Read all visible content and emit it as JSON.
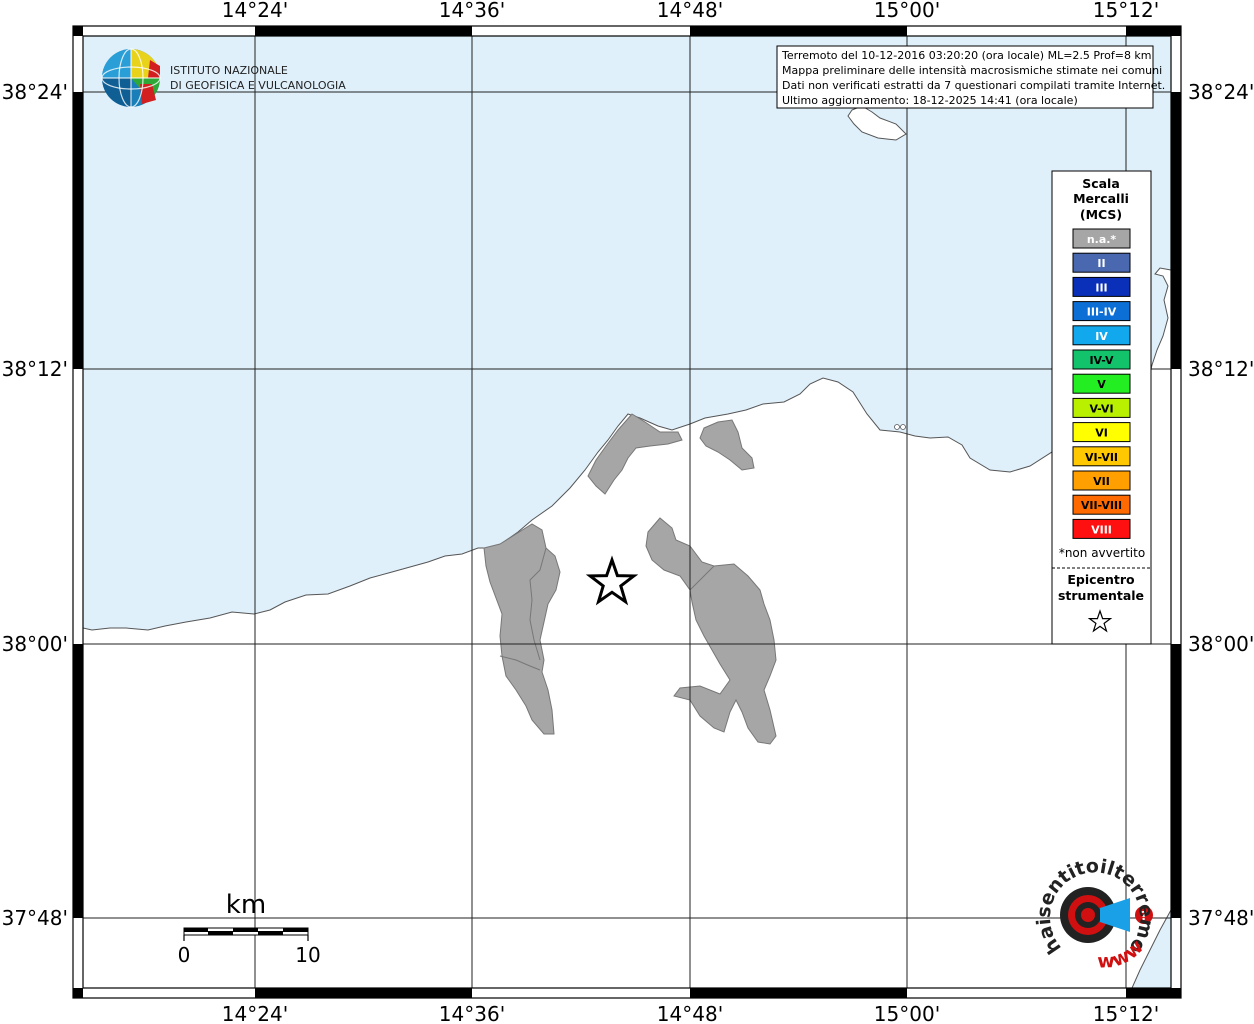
{
  "map": {
    "longitude_labels": [
      "14°24'",
      "14°36'",
      "14°48'",
      "15°00'",
      "15°12'"
    ],
    "latitude_labels": [
      "38°24'",
      "38°12'",
      "38°00'",
      "37°48'"
    ],
    "colors": {
      "sea": "#dff0fb",
      "land": "#ffffff",
      "municipality_na": "#a6a6a6",
      "grid": "#000000"
    }
  },
  "header": {
    "logo_line1": "ISTITUTO NAZIONALE",
    "logo_line2": "DI GEOFISICA E VULCANOLOGIA"
  },
  "info_box": {
    "line1": "Terremoto del 10-12-2016 03:20:20 (ora locale) ML=2.5 Prof=8 km",
    "line2": "Mappa preliminare delle intensità macrosismiche stimate nei comuni",
    "line3": "Dati non verificati estratti da 7 questionari compilati tramite Internet.",
    "line4": "Ultimo aggiornamento: 18-12-2025 14:41 (ora locale)"
  },
  "legend": {
    "title1": "Scala",
    "title2": "Mercalli",
    "title3": "(MCS)",
    "classes": [
      {
        "label": "n.a.*",
        "color": "#a6a6a6"
      },
      {
        "label": "II",
        "color": "#4a68b0"
      },
      {
        "label": "III",
        "color": "#0a2fb8"
      },
      {
        "label": "III-IV",
        "color": "#0c6fd6"
      },
      {
        "label": "IV",
        "color": "#12a8ee"
      },
      {
        "label": "IV-V",
        "color": "#13c36b"
      },
      {
        "label": "V",
        "color": "#22ee22"
      },
      {
        "label": "V-VI",
        "color": "#b8f000"
      },
      {
        "label": "VI",
        "color": "#ffff00"
      },
      {
        "label": "VI-VII",
        "color": "#ffc800"
      },
      {
        "label": "VII",
        "color": "#ffa000"
      },
      {
        "label": "VII-VIII",
        "color": "#ff6a00"
      },
      {
        "label": "VIII",
        "color": "#ff1010"
      }
    ],
    "not_felt_note": "*non avvertito",
    "epicenter_label1": "Epicentro",
    "epicenter_label2": "strumentale",
    "epicenter_icon": "star-outline-icon"
  },
  "scalebar": {
    "unit": "km",
    "start_label": "0",
    "end_label": "10"
  },
  "watermark": {
    "text_main": "haisentitoilterremoto.it",
    "text_prefix": "www.",
    "icon": "megaphone-target-icon",
    "accent_color": "#d01010"
  }
}
